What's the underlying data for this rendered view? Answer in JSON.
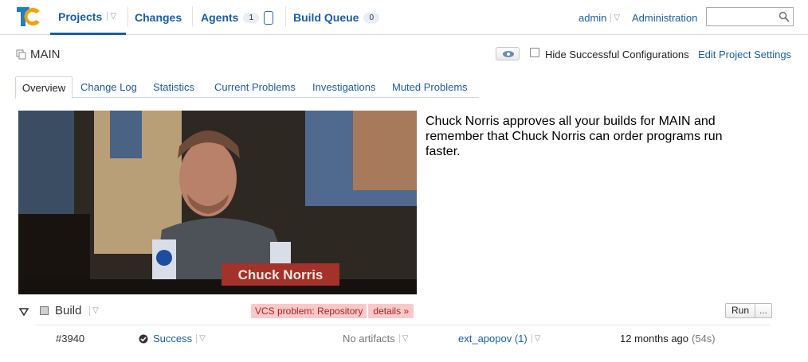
{
  "nav": {
    "projects": "Projects",
    "changes": "Changes",
    "agents": "Agents",
    "agents_count": "1",
    "build_queue": "Build Queue",
    "queue_count": "0",
    "user": "admin",
    "administration": "Administration",
    "search_placeholder": ""
  },
  "project": {
    "name": "MAIN",
    "hide_successful_label": "Hide Successful Configurations",
    "edit_settings": "Edit Project Settings"
  },
  "tabs": [
    "Overview",
    "Change Log",
    "Statistics",
    "Current Problems",
    "Investigations",
    "Muted Problems"
  ],
  "overview": {
    "image_caption": "Chuck Norris",
    "quote": "Chuck Norris approves all your builds for MAIN and remember that Chuck Norris can order programs run faster."
  },
  "build_config": {
    "name": "Build",
    "vcs_problem": "VCS problem: Repository",
    "details": "details »",
    "run": "Run",
    "more": "...",
    "last_build": {
      "number": "#3940",
      "status": "Success",
      "artifacts": "No artifacts",
      "trigger": "ext_apopov (1)",
      "time": "12 months ago",
      "duration": "(54s)"
    }
  },
  "colors": {
    "link": "#1a5ea6",
    "vcs_bg": "#f9c9c9",
    "vcs_text": "#b42121"
  }
}
